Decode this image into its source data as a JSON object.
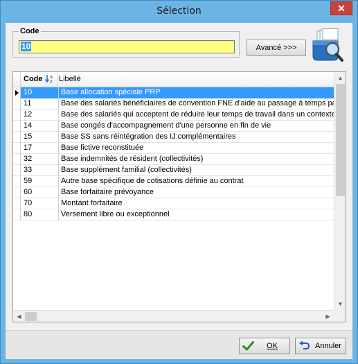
{
  "window": {
    "title": "Sélection",
    "close_glyph": "✕"
  },
  "code_group": {
    "legend": "Code",
    "value": "10"
  },
  "advanced_button": {
    "label": "Avancé >>>"
  },
  "grid": {
    "headers": {
      "code": "Code",
      "label": "Libellé"
    },
    "sort_icon": "sort-ascending-icon",
    "selected_index": 0,
    "rows": [
      {
        "code": "10",
        "label": "Base allocation spéciale PRP"
      },
      {
        "code": "11",
        "label": "Base des salariés bénéficiaires de convention FNE d'aide au passage à temps partie"
      },
      {
        "code": "12",
        "label": "Base des salariés qui acceptent de réduire leur temps de travail dans un contexte éc"
      },
      {
        "code": "14",
        "label": "Base congés d'accompagnement d'une personne en fin de vie"
      },
      {
        "code": "15",
        "label": "Base SS sans réintégration des IJ complémentaires"
      },
      {
        "code": "17",
        "label": "Base fictive reconstituée"
      },
      {
        "code": "32",
        "label": "Base indemnités de résident (collectivités)"
      },
      {
        "code": "33",
        "label": "Base supplément familial (collectivités)"
      },
      {
        "code": "59",
        "label": "Autre base spécifique de cotisations définie au contrat"
      },
      {
        "code": "60",
        "label": "Base forfaitaire prévoyance"
      },
      {
        "code": "70",
        "label": "Montant forfaitaire"
      },
      {
        "code": "80",
        "label": "Versement libre ou exceptionnel"
      }
    ]
  },
  "footer": {
    "ok_label": "OK",
    "cancel_label": "Annuler"
  },
  "colors": {
    "titlebar": "#6cb4e4",
    "selection": "#3399ff",
    "input_bg": "#ffff80",
    "close": "#c7423b"
  }
}
